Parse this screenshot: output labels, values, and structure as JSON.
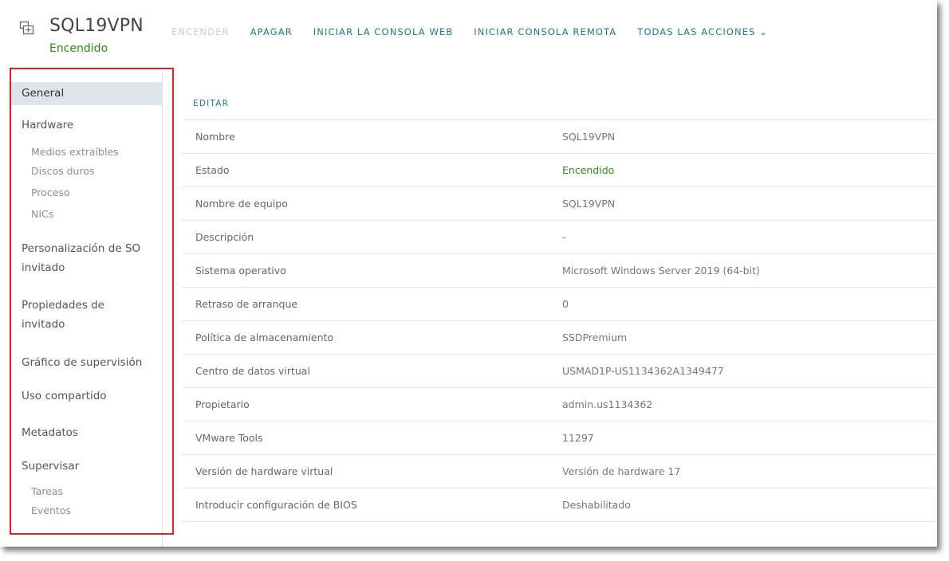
{
  "header": {
    "vm_name": "SQL19VPN",
    "vm_state": "Encendido",
    "actions": [
      {
        "label": "ENCENDER",
        "enabled": false
      },
      {
        "label": "APAGAR",
        "enabled": true
      },
      {
        "label": "INICIAR LA CONSOLA WEB",
        "enabled": true
      },
      {
        "label": "INICIAR CONSOLA REMOTA",
        "enabled": true
      },
      {
        "label": "TODAS LAS ACCIONES",
        "enabled": true
      }
    ]
  },
  "sidebar": {
    "items": [
      {
        "label": "General",
        "active": true
      },
      {
        "label": "Hardware"
      },
      {
        "label": "Medios extraíbles"
      },
      {
        "label": "Discos duros"
      },
      {
        "label": "Proceso"
      },
      {
        "label": "NICs"
      },
      {
        "label": "Personalización de SO"
      },
      {
        "label": "invitado"
      },
      {
        "label": "Propiedades de"
      },
      {
        "label": "invitado"
      },
      {
        "label": "Gráfico de supervisión"
      },
      {
        "label": "Uso compartido"
      },
      {
        "label": "Metadatos"
      },
      {
        "label": "Supervisar"
      },
      {
        "label": "Tareas"
      },
      {
        "label": "Eventos"
      }
    ]
  },
  "main": {
    "edit_label": "EDITAR",
    "properties": [
      {
        "key": "Nombre",
        "value": "SQL19VPN"
      },
      {
        "key": "Estado",
        "value": "Encendido"
      },
      {
        "key": "Nombre de equipo",
        "value": "SQL19VPN"
      },
      {
        "key": "Descripción",
        "value": "-"
      },
      {
        "key": "Sistema operativo",
        "value": "Microsoft Windows Server 2019 (64-bit)"
      },
      {
        "key": "Retraso de arranque",
        "value": "0"
      },
      {
        "key": "Política de almacenamiento",
        "value": "SSDPremium"
      },
      {
        "key": "Centro de datos virtual",
        "value": "USMAD1P-US1134362A1349477"
      },
      {
        "key": "Propietario",
        "value": "admin.us1134362"
      },
      {
        "key": "VMware Tools",
        "value": "11297"
      },
      {
        "key": "Versión de hardware virtual",
        "value": "Versión de hardware 17"
      },
      {
        "key": "Introducir configuración de BIOS",
        "value": "Deshabilitado"
      }
    ]
  },
  "colors": {
    "accent": "#1a7a8c",
    "status_green": "#2e8a18",
    "highlight_frame": "#e02020",
    "active_nav_bg": "#dde4ea"
  }
}
